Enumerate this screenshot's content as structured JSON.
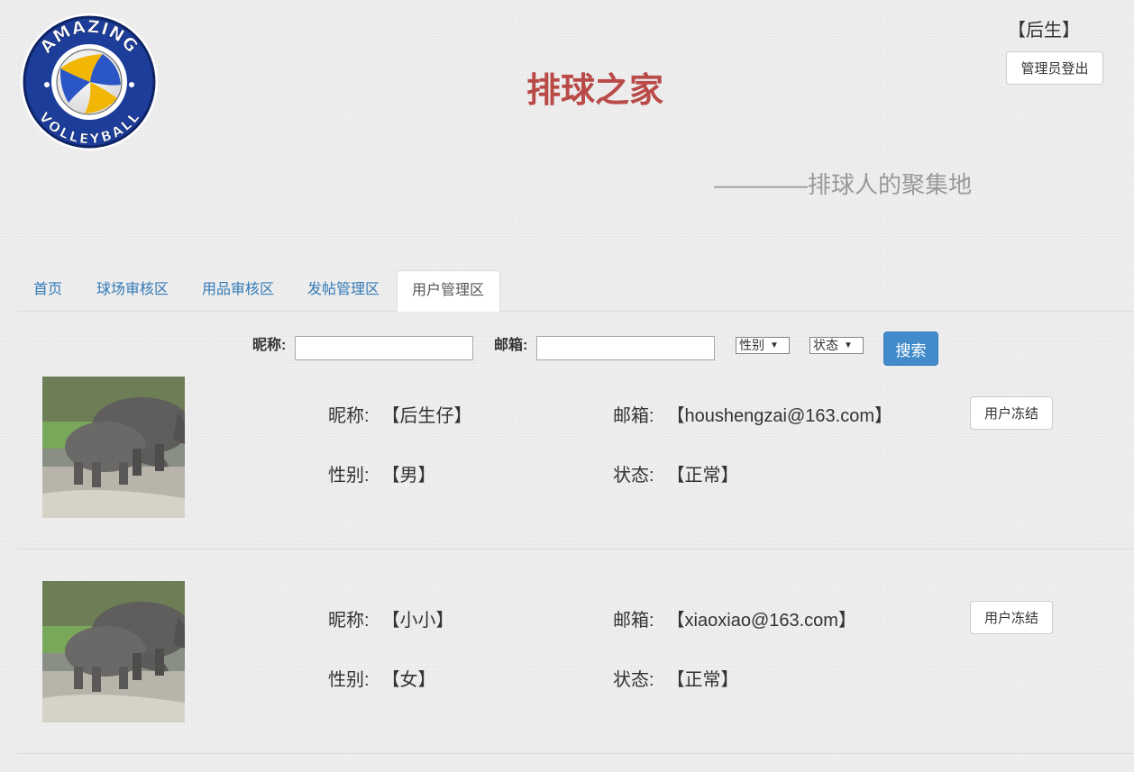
{
  "header": {
    "logo_text_top": "AMAZING",
    "logo_text_bottom": "VOLLEYBALL",
    "title": "排球之家",
    "subtitle": "————排球人的聚集地",
    "admin_name": "【后生】",
    "logout_label": "管理员登出"
  },
  "tabs": [
    {
      "label": "首页",
      "active": false
    },
    {
      "label": "球场审核区",
      "active": false
    },
    {
      "label": "用品审核区",
      "active": false
    },
    {
      "label": "发帖管理区",
      "active": false
    },
    {
      "label": "用户管理区",
      "active": true
    }
  ],
  "search": {
    "nickname_label": "昵称:",
    "nickname_value": "",
    "email_label": "邮箱:",
    "email_value": "",
    "gender_select": "性别",
    "status_select": "状态",
    "button_label": "搜索"
  },
  "colors": {
    "title": "#b94a48",
    "primary": "#428bca",
    "link": "#337ab7"
  },
  "users": [
    {
      "nickname_label": "昵称:",
      "nickname": "【后生仔】",
      "email_label": "邮箱:",
      "email": "【houshengzai@163.com】",
      "gender_label": "性别:",
      "gender": "【男】",
      "status_label": "状态:",
      "status": "【正常】",
      "action_label": "用户冻结"
    },
    {
      "nickname_label": "昵称:",
      "nickname": "【小小】",
      "email_label": "邮箱:",
      "email": "【xiaoxiao@163.com】",
      "gender_label": "性别:",
      "gender": "【女】",
      "status_label": "状态:",
      "status": "【正常】",
      "action_label": "用户冻结"
    }
  ]
}
